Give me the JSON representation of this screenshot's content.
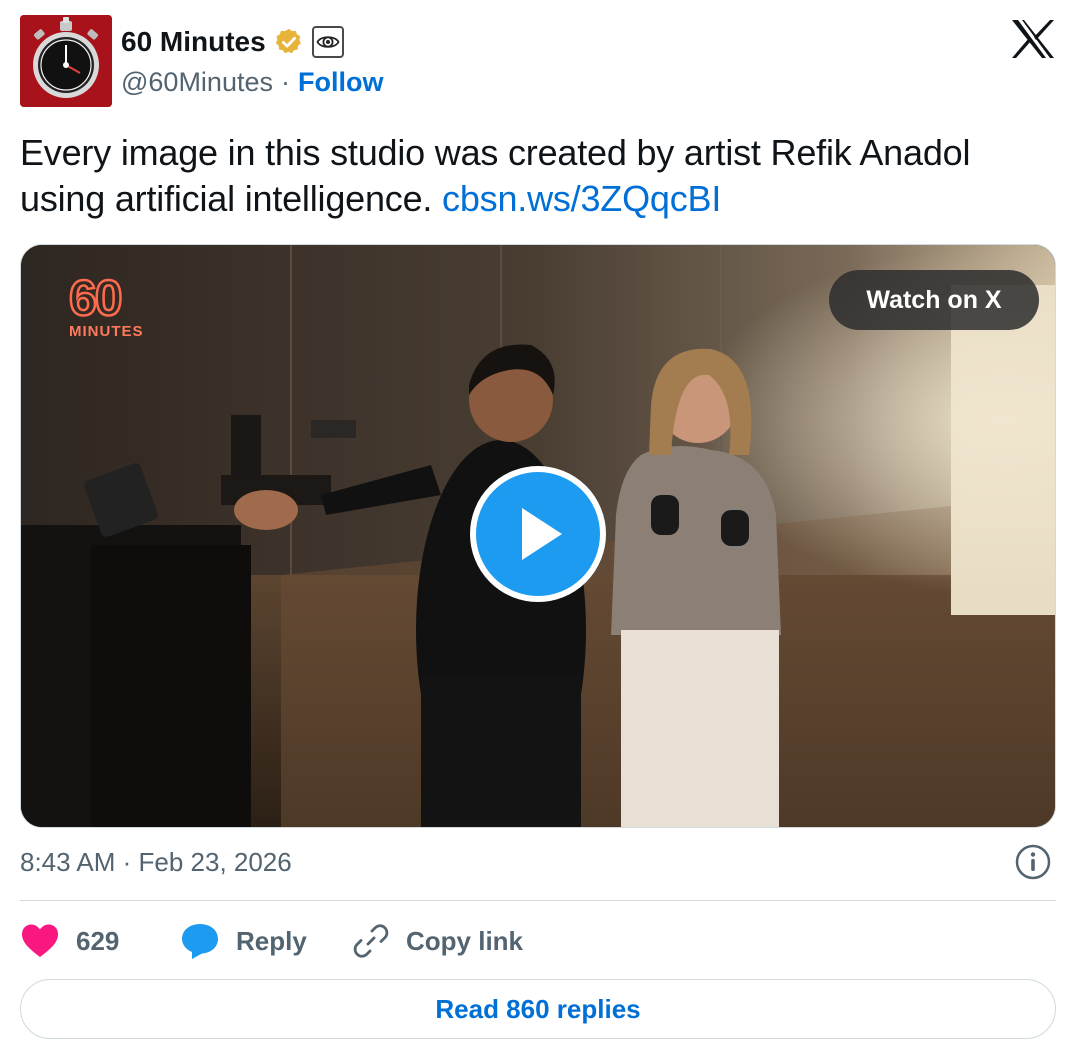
{
  "author": {
    "display_name": "60 Minutes",
    "handle": "@60Minutes",
    "separator": "·",
    "follow_label": "Follow"
  },
  "tweet": {
    "text": "Every image in this studio was created by artist Refik Anadol using artificial intelligence.",
    "link": "cbsn.ws/3ZQqcBI"
  },
  "media": {
    "watch_label": "Watch on X",
    "brand_number": "60",
    "brand_word": "MINUTES"
  },
  "timestamp": "8:43 AM · Feb 23, 2026",
  "actions": {
    "like_count": "629",
    "reply_label": "Reply",
    "copy_label": "Copy link"
  },
  "read_replies_label": "Read 860 replies",
  "colors": {
    "link_blue": "#006fd6",
    "play_blue": "#1d9bf0",
    "like_pink": "#f91880",
    "muted_gray": "#536471",
    "border": "#cfd9de",
    "avatar_red": "#b3141c"
  },
  "icons": [
    "verified-badge-icon",
    "cbs-eye-icon",
    "x-logo-icon",
    "play-icon",
    "info-icon",
    "heart-icon",
    "reply-bubble-icon",
    "link-icon"
  ]
}
